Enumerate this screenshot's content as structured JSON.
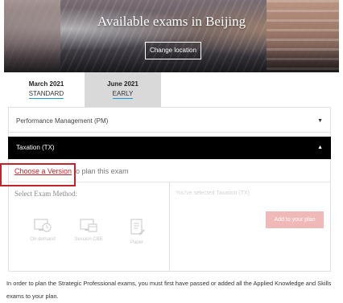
{
  "hero": {
    "title": "Available exams in Beijing",
    "change_location_label": "Change location"
  },
  "tabs": [
    {
      "month": "March 2021",
      "label": "STANDARD"
    },
    {
      "month": "June 2021",
      "label": "EARLY"
    }
  ],
  "accordion": {
    "pm_label": "Performance Management (PM)",
    "tx_label": "Taxation (TX)",
    "chevron_down": "▼",
    "chevron_up": "▲"
  },
  "version": {
    "link_text": "Choose a Version",
    "suffix": " to plan this exam"
  },
  "method": {
    "label": "Select Exam Method:",
    "options": [
      {
        "label": "On demand",
        "icon": "monitor-clock-icon"
      },
      {
        "label": "Session CBE",
        "icon": "monitor-calendar-icon"
      },
      {
        "label": "Paper",
        "icon": "paper-pencil-icon"
      }
    ]
  },
  "selection": {
    "selected_text": "You've selected Taxation (TX)",
    "add_button": "Add to your plan"
  },
  "footer": {
    "note": "In order to plan the Strategic Professional exams, you must first have passed or added all the Applied Knowledge and Skills exams to your plan."
  },
  "colors": {
    "accent_red": "#c0242b",
    "tab_underline": "#1a9bd7",
    "inactive_tab": "#d9d9d9",
    "disabled_button": "#f1b8b8"
  }
}
